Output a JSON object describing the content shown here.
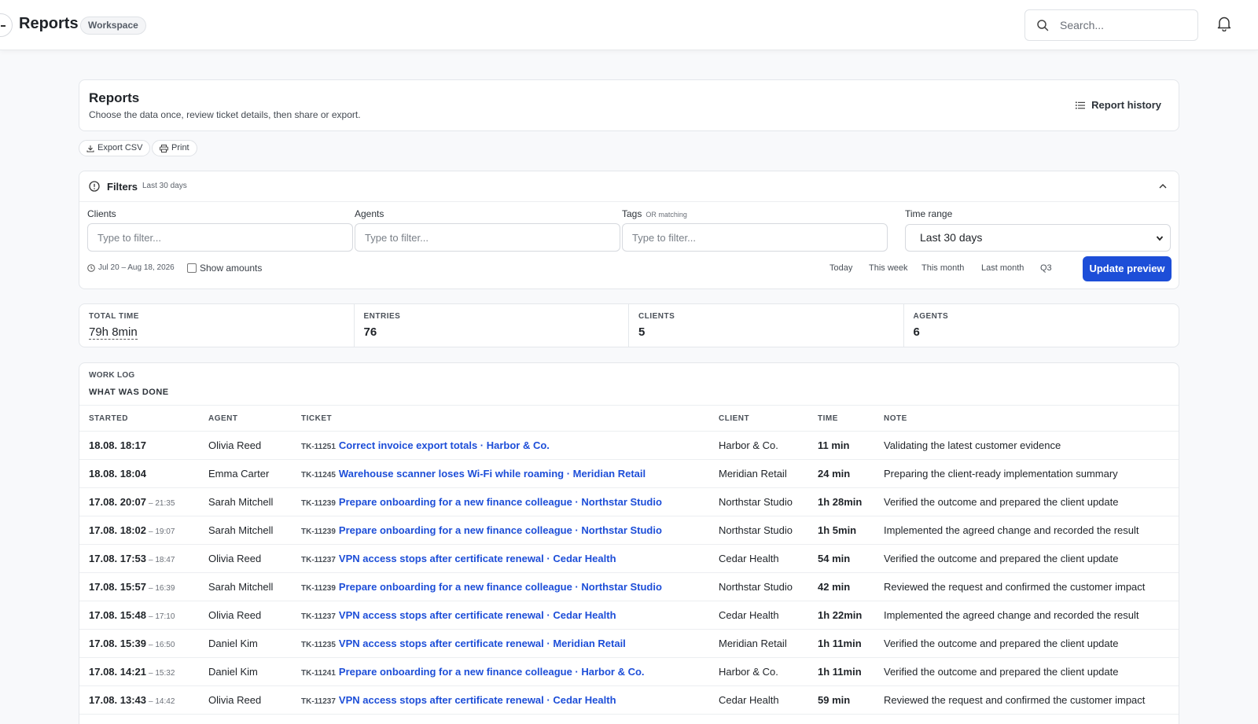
{
  "topbar": {
    "title": "Reports",
    "badge": "Workspace",
    "search_placeholder": "Search..."
  },
  "header": {
    "title": "Reports",
    "subtitle": "Choose the data once, review ticket details, then share or export.",
    "history_label": "Report history"
  },
  "actions": {
    "export_label": "Export CSV",
    "print_label": "Print"
  },
  "filters": {
    "title": "Filters",
    "range_hint": "Last 30 days",
    "clients_label": "Clients",
    "clients_placeholder": "Type to filter...",
    "agents_label": "Agents",
    "agents_placeholder": "Type to filter...",
    "tags_label": "Tags",
    "tags_hint": "OR matching",
    "tags_placeholder": "Type to filter...",
    "time_label": "Time range",
    "time_value": "Last 30 days",
    "date_span": "Jul 20 – Aug 18, 2026",
    "show_amounts_label": "Show amounts",
    "quick": [
      "Today",
      "This week",
      "This month",
      "Last month",
      "Q3"
    ],
    "update_label": "Update preview"
  },
  "stats": [
    {
      "label": "TOTAL TIME",
      "value": "79h 8min"
    },
    {
      "label": "ENTRIES",
      "value": "76"
    },
    {
      "label": "CLIENTS",
      "value": "5"
    },
    {
      "label": "AGENTS",
      "value": "6"
    }
  ],
  "worklog": {
    "kicker": "WORK LOG",
    "title": "WHAT WAS DONE",
    "columns": [
      "STARTED",
      "AGENT",
      "TICKET",
      "CLIENT",
      "TIME",
      "NOTE"
    ],
    "rows": [
      {
        "started": "18.08. 18:17",
        "end": "",
        "agent": "Olivia Reed",
        "ticket_id": "TK-11251",
        "ticket": "Correct invoice export totals · Harbor & Co.",
        "client": "Harbor & Co.",
        "time": "11 min",
        "note": "Validating the latest customer evidence"
      },
      {
        "started": "18.08. 18:04",
        "end": "",
        "agent": "Emma Carter",
        "ticket_id": "TK-11245",
        "ticket": "Warehouse scanner loses Wi-Fi while roaming · Meridian Retail",
        "client": "Meridian Retail",
        "time": "24 min",
        "note": "Preparing the client-ready implementation summary"
      },
      {
        "started": "17.08. 20:07",
        "end": "– 21:35",
        "agent": "Sarah Mitchell",
        "ticket_id": "TK-11239",
        "ticket": "Prepare onboarding for a new finance colleague · Northstar Studio",
        "client": "Northstar Studio",
        "time": "1h 28min",
        "note": "Verified the outcome and prepared the client update"
      },
      {
        "started": "17.08. 18:02",
        "end": "– 19:07",
        "agent": "Sarah Mitchell",
        "ticket_id": "TK-11239",
        "ticket": "Prepare onboarding for a new finance colleague · Northstar Studio",
        "client": "Northstar Studio",
        "time": "1h 5min",
        "note": "Implemented the agreed change and recorded the result"
      },
      {
        "started": "17.08. 17:53",
        "end": "– 18:47",
        "agent": "Olivia Reed",
        "ticket_id": "TK-11237",
        "ticket": "VPN access stops after certificate renewal · Cedar Health",
        "client": "Cedar Health",
        "time": "54 min",
        "note": "Verified the outcome and prepared the client update"
      },
      {
        "started": "17.08. 15:57",
        "end": "– 16:39",
        "agent": "Sarah Mitchell",
        "ticket_id": "TK-11239",
        "ticket": "Prepare onboarding for a new finance colleague · Northstar Studio",
        "client": "Northstar Studio",
        "time": "42 min",
        "note": "Reviewed the request and confirmed the customer impact"
      },
      {
        "started": "17.08. 15:48",
        "end": "– 17:10",
        "agent": "Olivia Reed",
        "ticket_id": "TK-11237",
        "ticket": "VPN access stops after certificate renewal · Cedar Health",
        "client": "Cedar Health",
        "time": "1h 22min",
        "note": "Implemented the agreed change and recorded the result"
      },
      {
        "started": "17.08. 15:39",
        "end": "– 16:50",
        "agent": "Daniel Kim",
        "ticket_id": "TK-11235",
        "ticket": "VPN access stops after certificate renewal · Meridian Retail",
        "client": "Meridian Retail",
        "time": "1h 11min",
        "note": "Verified the outcome and prepared the client update"
      },
      {
        "started": "17.08. 14:21",
        "end": "– 15:32",
        "agent": "Daniel Kim",
        "ticket_id": "TK-11241",
        "ticket": "Prepare onboarding for a new finance colleague · Harbor & Co.",
        "client": "Harbor & Co.",
        "time": "1h 11min",
        "note": "Verified the outcome and prepared the client update"
      },
      {
        "started": "17.08. 13:43",
        "end": "– 14:42",
        "agent": "Olivia Reed",
        "ticket_id": "TK-11237",
        "ticket": "VPN access stops after certificate renewal · Cedar Health",
        "client": "Cedar Health",
        "time": "59 min",
        "note": "Reviewed the request and confirmed the customer impact"
      }
    ]
  }
}
